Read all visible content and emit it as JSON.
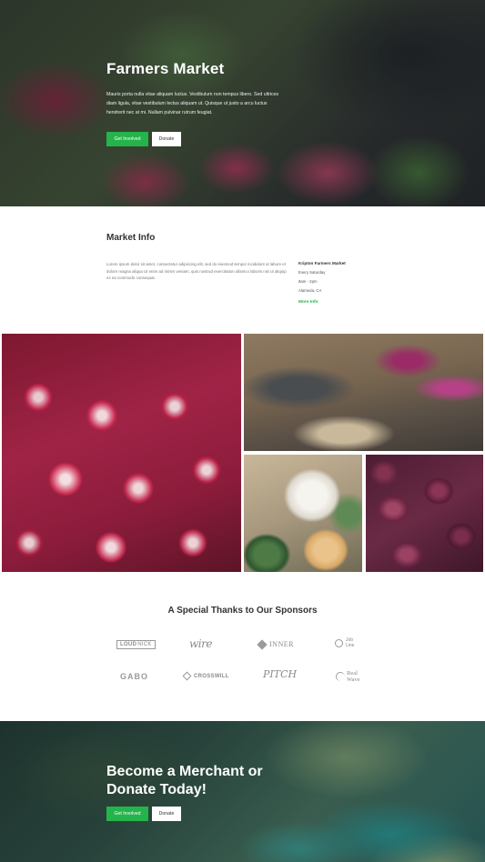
{
  "hero": {
    "title": "Farmers Market",
    "text": "Mauris porta nulla vitae aliquam luctus. Vestibulum non tempus libero. Sed ultrices diam ligula, vitae vestibulum lectus aliquam ut. Quisque ut justo a arcu luctus hendrerit nec at mi. Nullam pulvinar rutrum feugiat.",
    "primary_button": "Get Involved",
    "secondary_button": "Donate"
  },
  "market_info": {
    "title": "Market Info",
    "text": "Lorem ipsum dolor sit amet, consectetur adipiscing elit, sed do eiusmod tempor incididunt ut labore et dolore magna aliqua Ut enim ad minim veniam, quis nostrud exercitation ullamco laboris nisi ut aliquip ex ea commodo consequat.",
    "name": "Kripton Farmers Market",
    "day": "Every Saturday",
    "hours": "8am - 2pm",
    "location": "Alameda, CA",
    "link": "More Info"
  },
  "sponsors": {
    "title": "A Special Thanks to Our Sponsors",
    "logos": {
      "loudnick_a": "LOUD",
      "loudnick_b": "NICK",
      "wire": "wire",
      "inner": "INNER",
      "job_a": "Job",
      "job_b": "Line",
      "gabo": "GABO",
      "crosswill": "CROSSWILL",
      "pitch": "PITCH",
      "real_a": "Real",
      "real_b": "Wave"
    }
  },
  "cta": {
    "title": "Become a Merchant or Donate Today!",
    "primary_button": "Get Involved",
    "secondary_button": "Donate"
  },
  "colors": {
    "accent_green": "#25b34b",
    "text_dark": "#333333",
    "logo_gray": "#8a8a8a"
  }
}
